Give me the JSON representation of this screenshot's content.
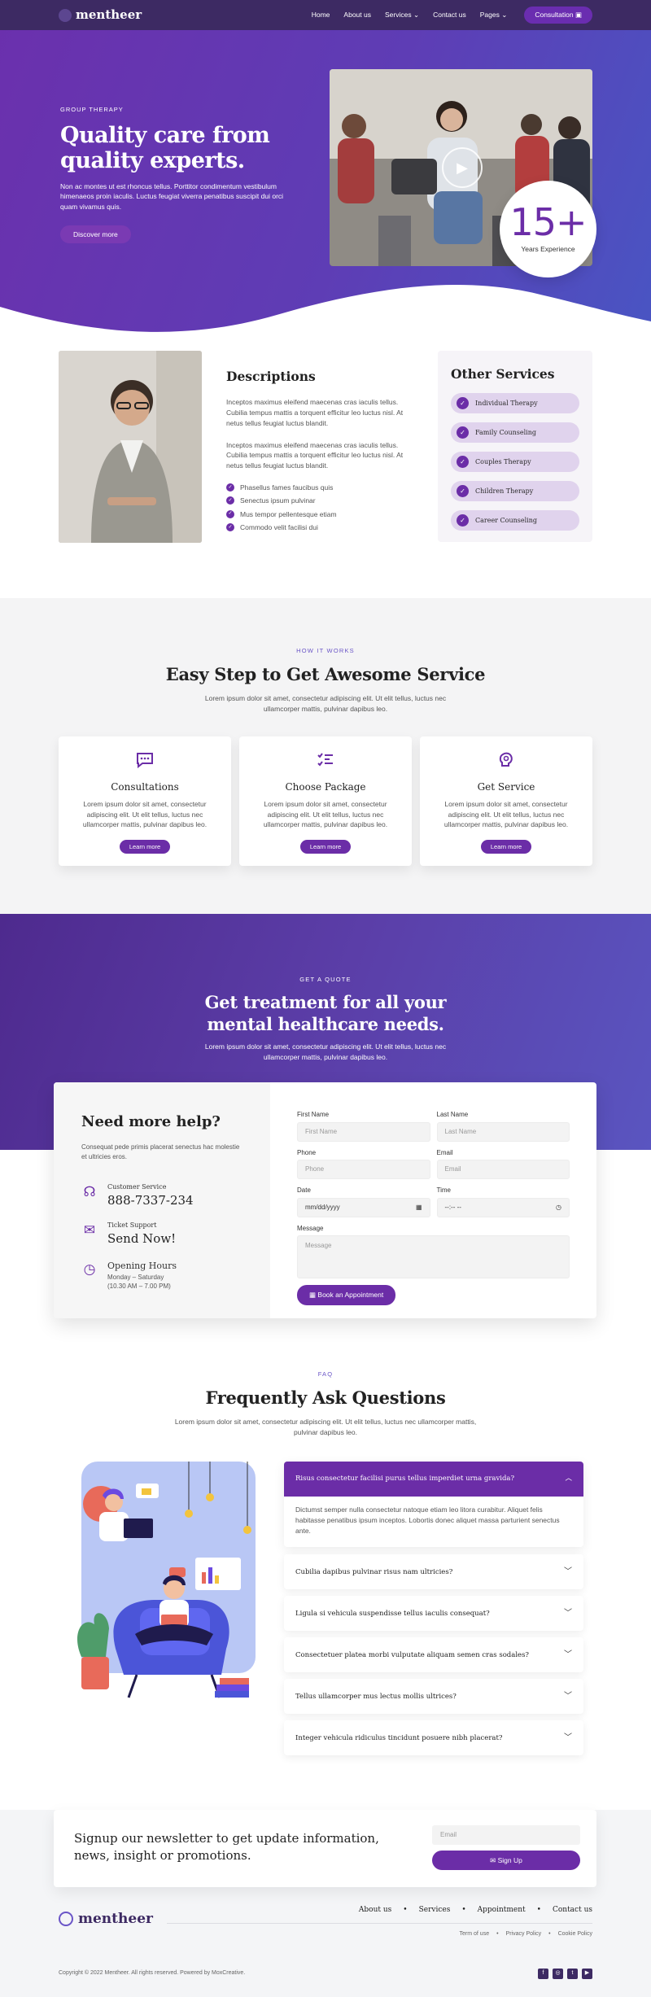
{
  "colors": {
    "brand": "#6b2da7",
    "nav_bg": "#3d2a63",
    "accent_blue": "#4955c3",
    "badge_num": "#6b2da7"
  },
  "nav": {
    "logo": "mentheer",
    "links": [
      {
        "label": "Home"
      },
      {
        "label": "About us"
      },
      {
        "label": "Services",
        "dropdown": true
      },
      {
        "label": "Contact us"
      },
      {
        "label": "Pages",
        "dropdown": true
      }
    ],
    "cta": "Consultation"
  },
  "hero": {
    "eyebrow": "GROUP THERAPY",
    "title": "Quality care from quality experts.",
    "desc": "Non ac montes ut est rhoncus tellus. Porttitor condimentum vestibulum himenaeos proin iaculis. Luctus feugiat viverra penatibus suscipit dui orci quam vivamus quis.",
    "cta": "Discover more",
    "badge": {
      "number": "15+",
      "label": "Years Experience"
    }
  },
  "descriptions": {
    "title": "Descriptions",
    "p1": "Inceptos maximus eleifend maecenas cras iaculis tellus. Cubilia tempus mattis a torquent efficitur leo luctus nisl. At netus tellus feugiat luctus blandit.",
    "p2": "Inceptos maximus eleifend maecenas cras iaculis tellus. Cubilia tempus mattis a torquent efficitur leo luctus nisl. At netus tellus feugiat luctus blandit.",
    "checks": [
      "Phasellus fames faucibus quis",
      "Senectus ipsum pulvinar",
      "Mus tempor pellentesque etiam",
      "Commodo velit facilisi dui"
    ]
  },
  "other_services": {
    "title": "Other Services",
    "items": [
      "Individual Therapy",
      "Family Counseling",
      "Couples Therapy",
      "Children Therapy",
      "Career Counseling"
    ]
  },
  "how": {
    "eyebrow": "HOW IT WORKS",
    "title": "Easy Step to Get Awesome Service",
    "sub": "Lorem ipsum dolor sit amet, consectetur adipiscing elit. Ut elit tellus, luctus nec ullamcorper mattis, pulvinar dapibus leo.",
    "cards": [
      {
        "icon": "chat-icon",
        "title": "Consultations",
        "text": "Lorem ipsum dolor sit amet, consectetur adipiscing elit. Ut elit tellus, luctus nec ullamcorper mattis, pulvinar dapibus leo.",
        "btn": "Learn more"
      },
      {
        "icon": "checklist-icon",
        "title": "Choose Package",
        "text": "Lorem ipsum dolor sit amet, consectetur adipiscing elit. Ut elit tellus, luctus nec ullamcorper mattis, pulvinar dapibus leo.",
        "btn": "Learn more"
      },
      {
        "icon": "brain-icon",
        "title": "Get Service",
        "text": "Lorem ipsum dolor sit amet, consectetur adipiscing elit. Ut elit tellus, luctus nec ullamcorper mattis, pulvinar dapibus leo.",
        "btn": "Learn more"
      }
    ]
  },
  "quote": {
    "eyebrow": "GET A QUOTE",
    "title": "Get treatment for all your mental healthcare needs.",
    "sub": "Lorem ipsum dolor sit amet, consectetur adipiscing elit. Ut elit tellus, luctus nec ullamcorper mattis, pulvinar dapibus leo."
  },
  "help": {
    "title": "Need more help?",
    "desc": "Consequat pede primis placerat senectus hac molestie et ultricies eros.",
    "contacts": [
      {
        "icon": "headset-icon",
        "label": "Customer Service",
        "value": "888-7337-234"
      },
      {
        "icon": "mail-icon",
        "label": "Ticket Support",
        "value": "Send Now!"
      },
      {
        "icon": "clock-icon",
        "label": "Opening Hours",
        "lines": [
          "Monday – Saturday",
          "(10.30 AM – 7.00 PM)"
        ]
      }
    ]
  },
  "form": {
    "first_name": {
      "label": "First Name",
      "placeholder": "First Name"
    },
    "last_name": {
      "label": "Last Name",
      "placeholder": "Last Name"
    },
    "phone": {
      "label": "Phone",
      "placeholder": "Phone"
    },
    "email": {
      "label": "Email",
      "placeholder": "Email"
    },
    "date": {
      "label": "Date",
      "placeholder": "mm/dd/yyyy"
    },
    "time": {
      "label": "Time",
      "placeholder": "--:-- --"
    },
    "message": {
      "label": "Message",
      "placeholder": "Message"
    },
    "submit": "Book an Appointment"
  },
  "faq": {
    "eyebrow": "FAQ",
    "title": "Frequently Ask Questions",
    "sub": "Lorem ipsum dolor sit amet, consectetur adipiscing elit. Ut elit tellus, luctus nec ullamcorper mattis, pulvinar dapibus leo.",
    "open": {
      "q": "Risus consectetur facilisi purus tellus imperdiet urna gravida?",
      "a": "Dictumst semper nulla consectetur natoque etiam leo litora curabitur. Aliquet felis habitasse penatibus ipsum inceptos. Lobortis donec aliquet massa parturient senectus ante."
    },
    "items": [
      "Cubilia dapibus pulvinar risus nam ultricies?",
      "Ligula si vehicula suspendisse tellus iaculis consequat?",
      "Consectetuer platea morbi vulputate aliquam semen cras sodales?",
      "Tellus ullamcorper mus lectus mollis ultrices?",
      "Integer vehicula ridiculus tincidunt posuere nibh placerat?"
    ]
  },
  "newsletter": {
    "text": "Signup our newsletter to get update information, news, insight or promotions.",
    "placeholder": "Email",
    "btn": "Sign Up"
  },
  "footer": {
    "logo": "mentheer",
    "nav": [
      "About us",
      "Services",
      "Appointment",
      "Contact us"
    ],
    "legal": [
      "Term of use",
      "Privacy Policy",
      "Cookie Policy"
    ],
    "copyright": "Copyright © 2022 Mentheer. All rights reserved. Powered by MoxCreative.",
    "socials": [
      "facebook-icon",
      "instagram-icon",
      "twitter-icon",
      "youtube-icon"
    ]
  }
}
